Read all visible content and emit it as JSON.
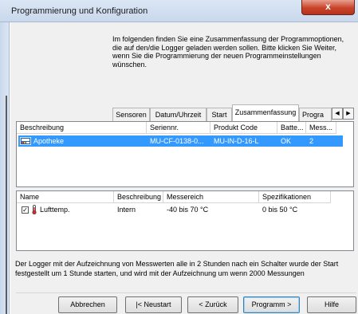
{
  "window": {
    "title": "Programmierung und Konfiguration",
    "close_glyph": "x"
  },
  "intro_text": "Im folgenden finden Sie eine Zusammenfassung der Programmoptionen, die auf den/die Logger geladen werden sollen. Bitte klicken Sie Weiter, wenn Sie die Programmierung der neuen Programmeinstellungen wünschen.",
  "tabs": [
    {
      "label": "Sensoren",
      "active": false
    },
    {
      "label": "Datum/Uhrzeit",
      "active": false
    },
    {
      "label": "Start",
      "active": false
    },
    {
      "label": "Zusammenfassung",
      "active": true
    },
    {
      "label": "Progra",
      "active": false
    }
  ],
  "tab_scroll": {
    "left": "◀",
    "right": "▶"
  },
  "logger_list": {
    "columns": [
      "Beschreibung",
      "Seriennr.",
      "Produkt Code",
      "Batte...",
      "Mess..."
    ],
    "rows": [
      {
        "beschreibung": "Apotheke",
        "seriennr": "MU-CF-0138-0...",
        "produkt_code": "MU-IN-D-16-L",
        "batterie": "OK",
        "mess": "2",
        "selected": true
      }
    ],
    "selection_color": "#3399ff"
  },
  "sensor_list": {
    "columns": [
      "Name",
      "Beschreibung",
      "Messereich",
      "Spezifikationen"
    ],
    "rows": [
      {
        "name": "Lufttemp.",
        "beschreibung": "Intern",
        "messbereich": "-40 bis 70 °C",
        "spezifikationen": "0 bis 50 °C",
        "checked": true
      }
    ]
  },
  "footer_text": "Der Logger mit der Aufzeichnung von Messwerten alle in 2 Stunden nach ein Schalter wurde der Start festgestellt um 1 Stunde starten, und wird mit der Aufzeichnung um wenn 2000 Messungen",
  "buttons": {
    "cancel": "Abbrechen",
    "restart": "|< Neustart",
    "back": "< Zurück",
    "next": "Programm >",
    "help": "Hilfe"
  },
  "icons": {
    "logger": "logger-device-icon",
    "thermometer": "thermometer-icon"
  },
  "colors": {
    "accent": "#3399ff",
    "close_button": "#c9432a"
  }
}
